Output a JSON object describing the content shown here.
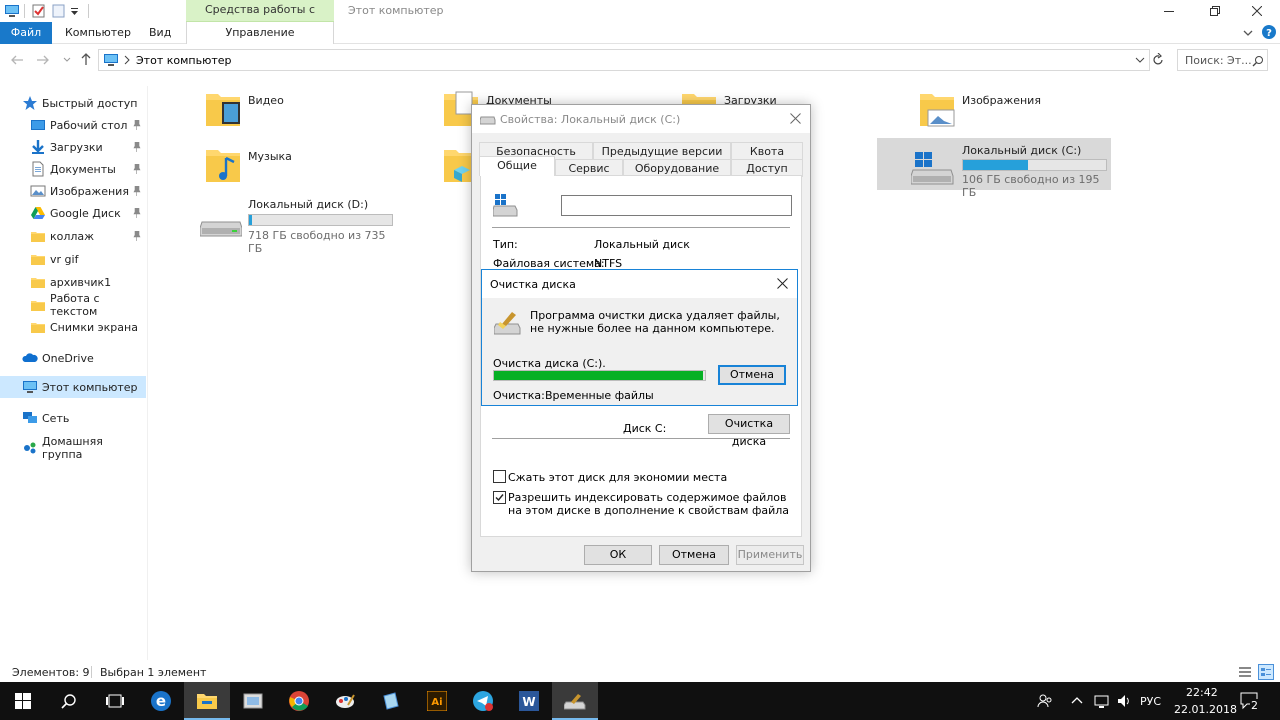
{
  "window": {
    "title": "Этот компьютер",
    "context_tab": "Средства работы с дисками"
  },
  "ribbon": {
    "tabs": [
      "Файл",
      "Компьютер",
      "Вид",
      "Управление"
    ]
  },
  "address": {
    "path": "Этот компьютер",
    "search_placeholder": "Поиск: Эт..."
  },
  "sidebar": {
    "quick_access": "Быстрый доступ",
    "items": [
      {
        "label": "Рабочий стол",
        "pinned": true
      },
      {
        "label": "Загрузки",
        "pinned": true
      },
      {
        "label": "Документы",
        "pinned": true
      },
      {
        "label": "Изображения",
        "pinned": true
      },
      {
        "label": "Google Диск",
        "pinned": true
      },
      {
        "label": "коллаж",
        "pinned": true
      },
      {
        "label": "vr gif",
        "pinned": false
      },
      {
        "label": "архивчик1",
        "pinned": false
      },
      {
        "label": "Работа с текстом",
        "pinned": false
      },
      {
        "label": "Снимки экрана",
        "pinned": false
      }
    ],
    "onedrive": "OneDrive",
    "this_pc": "Этот компьютер",
    "network": "Сеть",
    "homegroup": "Домашняя группа"
  },
  "content": {
    "folders": {
      "video": "Видео",
      "documents": "Документы",
      "downloads": "Загрузки",
      "pictures": "Изображения",
      "music": "Музыка"
    },
    "drives": {
      "c": {
        "label": "Локальный диск (C:)",
        "free": "106 ГБ свободно из 195 ГБ",
        "used_fraction": 0.456
      },
      "d": {
        "label": "Локальный диск (D:)",
        "free": "718 ГБ свободно из 735 ГБ",
        "used_fraction": 0.023
      }
    }
  },
  "status": {
    "items": "Элементов: 9",
    "selected": "Выбран 1 элемент"
  },
  "properties": {
    "title": "Свойства: Локальный диск (C:)",
    "tabs_row1": [
      "Безопасность",
      "Предыдущие версии",
      "Квота"
    ],
    "tabs_row2": [
      "Общие",
      "Сервис",
      "Оборудование",
      "Доступ"
    ],
    "name_value": "",
    "type_label": "Тип:",
    "type_value": "Локальный диск",
    "fs_label": "Файловая система:",
    "fs_value": "NTFS",
    "disk_label": "Диск C:",
    "cleanup_button": "Очистка диска",
    "compress_label": "Сжать этот диск для экономии места",
    "compress_checked": false,
    "index_label": "Разрешить индексировать содержимое файлов на этом диске в дополнение к свойствам файла",
    "index_checked": true,
    "ok": "ОК",
    "cancel": "Отмена",
    "apply": "Применить"
  },
  "cleanup": {
    "title": "Очистка диска",
    "message": "Программа очистки диска удаляет файлы, не нужные более на данном компьютере.",
    "progress_label": "Очистка диска  (C:).",
    "progress_fraction": 0.99,
    "cancel": "Отмена",
    "status_label": "Очистка:",
    "status_value": "Временные файлы"
  },
  "taskbar": {
    "time": "22:42",
    "date": "22.01.2018",
    "language": "РУС",
    "notifications": "2"
  },
  "colors": {
    "accent": "#1979ca",
    "drive_bar": "#26a0da",
    "progress": "#06b025",
    "selection": "#cce8ff"
  }
}
